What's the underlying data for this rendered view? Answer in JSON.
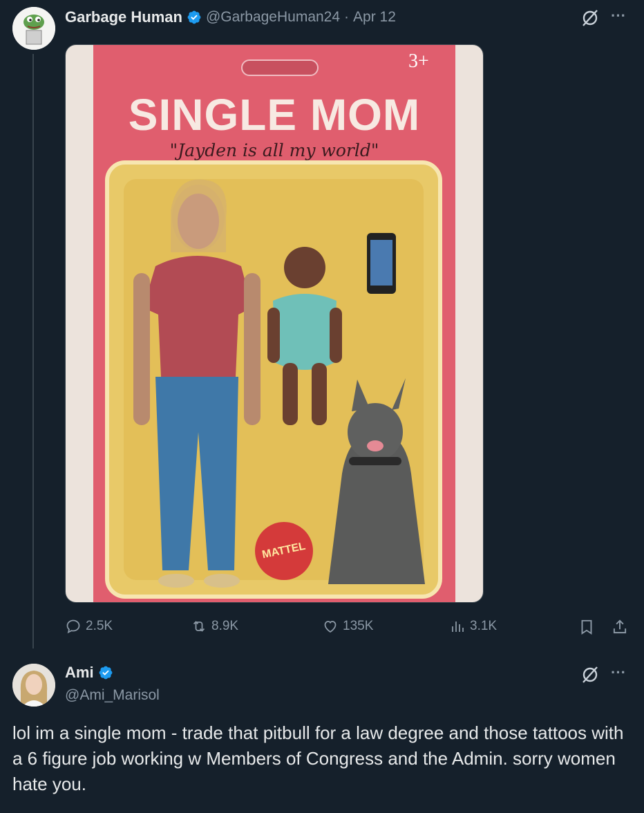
{
  "tweet": {
    "display_name": "Garbage Human",
    "handle": "@GarbageHuman24",
    "separator": "·",
    "date": "Apr 12",
    "more_label": "···",
    "image": {
      "age_label": "3+",
      "title": "SINGLE MOM",
      "subtitle": "\"Jayden is all my world\"",
      "brand": "MATTEL"
    },
    "actions": {
      "replies": "2.5K",
      "reposts": "8.9K",
      "likes": "135K",
      "views": "3.1K"
    }
  },
  "reply": {
    "display_name": "Ami",
    "handle": "@Ami_Marisol",
    "more_label": "···",
    "text": "lol im a single mom - trade that pitbull for a law degree and those tattoos with a 6 figure job working w Members of Congress and the Admin. sorry women hate you."
  },
  "colors": {
    "background": "#15202b",
    "text": "#e7e9ea",
    "muted": "#8b98a5",
    "verified": "#1d9bf0",
    "card_pink": "#e05e6e",
    "card_yellow": "#e3c25c"
  },
  "icons": [
    "grok-icon",
    "more-icon",
    "reply-icon",
    "repost-icon",
    "like-icon",
    "views-icon",
    "bookmark-icon",
    "share-icon",
    "verified-badge-icon"
  ]
}
